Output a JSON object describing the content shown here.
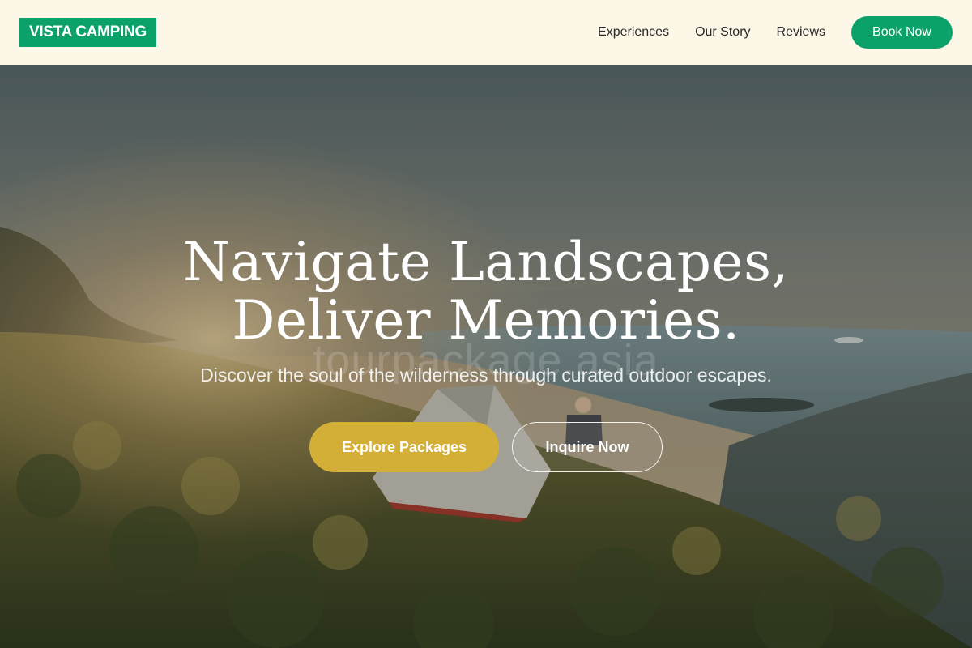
{
  "brand": {
    "logo_text": "VISTA CAMPING",
    "accent_color": "#0ba26a",
    "gold_color": "#d4af37",
    "nav_background": "#fdf7e8"
  },
  "nav": {
    "links": [
      {
        "label": "Experiences"
      },
      {
        "label": "Our Story"
      },
      {
        "label": "Reviews"
      }
    ],
    "cta_label": "Book Now"
  },
  "hero": {
    "title_line1": "Navigate Landscapes,",
    "title_line2": "Deliver Memories.",
    "subtitle": "Discover the soul of the wilderness through curated outdoor escapes.",
    "primary_button": "Explore Packages",
    "secondary_button": "Inquire Now",
    "watermark": "tourpackage.asia"
  }
}
